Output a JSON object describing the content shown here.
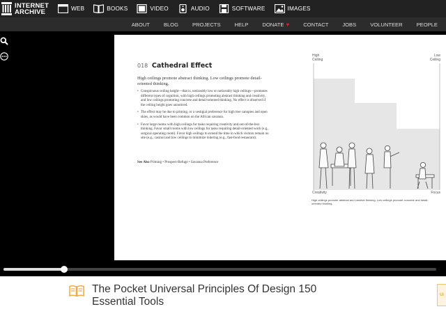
{
  "header": {
    "logo_text_line1": "INTERNET",
    "logo_text_line2": "ARCHIVE",
    "media_nav": [
      {
        "label": "WEB",
        "icon": "web-icon"
      },
      {
        "label": "BOOKS",
        "icon": "books-icon"
      },
      {
        "label": "VIDEO",
        "icon": "video-icon"
      },
      {
        "label": "AUDIO",
        "icon": "audio-icon"
      },
      {
        "label": "SOFTWARE",
        "icon": "software-icon"
      },
      {
        "label": "IMAGES",
        "icon": "images-icon"
      }
    ],
    "sub_nav": [
      "ABOUT",
      "BLOG",
      "PROJECTS",
      "HELP",
      "DONATE",
      "CONTACT",
      "JOBS",
      "VOLUNTEER",
      "PEOPLE"
    ]
  },
  "reader": {
    "tools": [
      "search-icon",
      "more-options-icon"
    ],
    "page": {
      "number": "018",
      "title": "Cathedral Effect",
      "intro": "High ceilings promote abstract thinking. Low ceilings promote detail-oriented thinking.",
      "bullets": [
        "Conspicuous ceiling height—that is, noticeably low or noticeably high ceilings—promotes different types of cognition, with high ceilings promoting abstract thinking and creativity, and low ceilings promoting concrete and detail-oriented thinking. No effect is observed if the ceiling height goes unnoticed.",
        "The effect may be due to priming, or a vestigial preference for high tree canopies and open skies, as would have been common on the African savanna.",
        "Favor large rooms with high ceilings for tasks requiring creativity and out-of-the-box thinking. Favor small rooms with low ceilings for tasks requiring detail-oriented work (e.g., surgical operating room). Favor high ceilings to extend the time in which visitors remain on site (e.g., casino) and low ceilings to minimize loitering (e.g., fast-food restaurant)."
      ],
      "see_also_label": "See Also",
      "see_also_items": "Priming • Prospect-Refuge • Savanna Preference",
      "figure": {
        "label_high": "High\nCeiling",
        "label_low": "Low\nCeiling",
        "label_left": "Creativity",
        "label_right": "Focus",
        "caption": "High ceilings promote abstract and creative thinking. Low ceilings promote concrete and detail-oriented thinking."
      }
    },
    "progress_fraction": 0.14
  },
  "book": {
    "title": "The Pocket Universal Principles Of Design 150 Essential Tools",
    "side_tab_text": "Ui"
  },
  "colors": {
    "topbar": "#222222",
    "subnav": "#2c2c2c",
    "viewer_bg": "#000000",
    "book_icon": "#f0a840",
    "donate_heart": "#e02020"
  }
}
